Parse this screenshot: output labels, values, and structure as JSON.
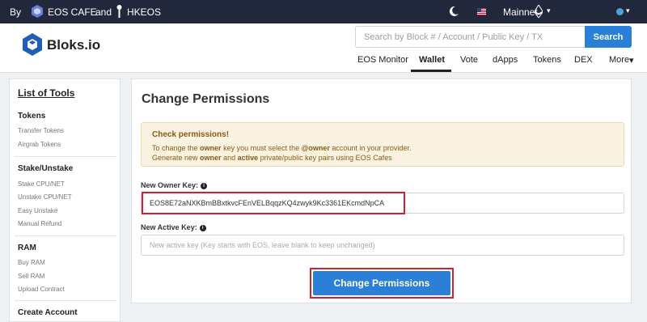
{
  "topbar": {
    "by": "By",
    "sponsor1": "EOS CAFE",
    "and": "and",
    "sponsor2": "HKEOS",
    "network": "Mainnet",
    "icons": [
      "eos-cafe-logo-icon",
      "hkeos-logo-icon",
      "moon-icon",
      "us-flag-icon",
      "ethereum-icon",
      "globe-icon"
    ]
  },
  "header": {
    "logo_text": "Bloks.io",
    "search": {
      "placeholder": "Search by Block # / Account / Public Key / TX",
      "value": ""
    },
    "search_button": "Search",
    "nav": [
      "EOS Monitor",
      "Wallet",
      "Vote",
      "dApps",
      "Tokens",
      "DEX",
      "More"
    ],
    "active_nav": "Wallet"
  },
  "sidebar": {
    "title": "List of Tools",
    "sections": [
      {
        "title": "Tokens",
        "items": [
          "Transfer Tokens",
          "Airgrab Tokens"
        ]
      },
      {
        "title": "Stake/Unstake",
        "items": [
          "Stake CPU/NET",
          "Unstake CPU/NET",
          "Easy Unstake",
          "Manual Refund"
        ]
      },
      {
        "title": "RAM",
        "items": [
          "Buy RAM",
          "Sell RAM",
          "Upload Contract"
        ]
      },
      {
        "title": "Create Account",
        "items": []
      }
    ]
  },
  "main": {
    "title": "Change Permissions",
    "alert": {
      "title": "Check permissions!",
      "line1": {
        "a": "To change the ",
        "b": "owner",
        "c": " key you must select the ",
        "d": "@owner",
        "e": " account in your provider."
      },
      "line2": {
        "a": "Generate new ",
        "b": "owner",
        "c": " and ",
        "d": "active",
        "e": " private/public key pairs using EOS Cafes"
      }
    },
    "owner_label": "New Owner Key:",
    "owner_value": "EOS8E72aNXKBmBBxtkvcFEnVELBqqzKQ4zwyk9Kc3361EKcmdNpCA",
    "active_label": "New Active Key:",
    "active_placeholder": "New active key (Key starts with EOS, leave blank to keep unchanged)",
    "submit": "Change Permissions"
  },
  "colors": {
    "topbar": "#22283c",
    "accent": "#2a7fd6",
    "highlight": "#d3202e",
    "alert_bg": "#fbf3e2"
  }
}
